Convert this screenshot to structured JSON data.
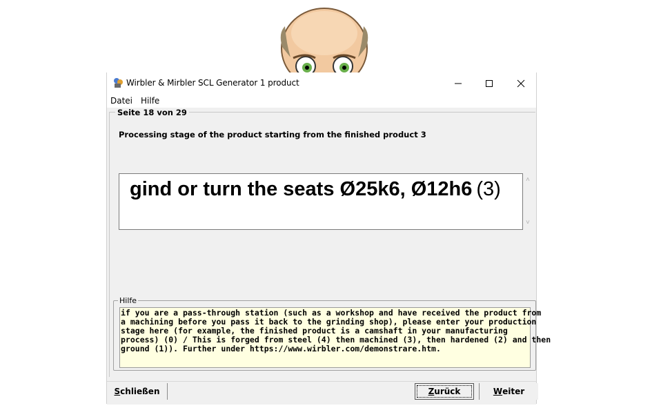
{
  "window": {
    "title": "Wirbler & Mirbler SCL Generator 1 product"
  },
  "menu": {
    "items": [
      "Datei",
      "Hilfe"
    ]
  },
  "page": {
    "indicator": "Seite 18 von 29",
    "heading": "Processing stage of the product starting from the finished product 3",
    "answer_main": "gind or turn the seats Ø25k6, Ø12h6",
    "answer_suffix": "(3)"
  },
  "help": {
    "legend": "Hilfe",
    "text": "if you are a pass-through station (such as a workshop and have received the product from\na machining before you pass it back to the grinding shop), please enter your production\nstage here (for example, the finished product is a camshaft in your manufacturing\nprocess) (0) / This is forged from steel (4) then machined (3), then hardened (2) and then\nground (1)). Further under https://www.wirbler.com/demonstrare.htm."
  },
  "buttons": {
    "close_first": "S",
    "close_rest": "chließen",
    "back_first": "Z",
    "back_rest": "urück",
    "next_first": "W",
    "next_rest": "eiter"
  },
  "icons": {
    "app": "app-icon",
    "minimize": "minimize-icon",
    "maximize": "maximize-icon",
    "close": "close-icon"
  },
  "colors": {
    "help_background": "#ffffe1",
    "window_background": "#f0f0f0"
  }
}
